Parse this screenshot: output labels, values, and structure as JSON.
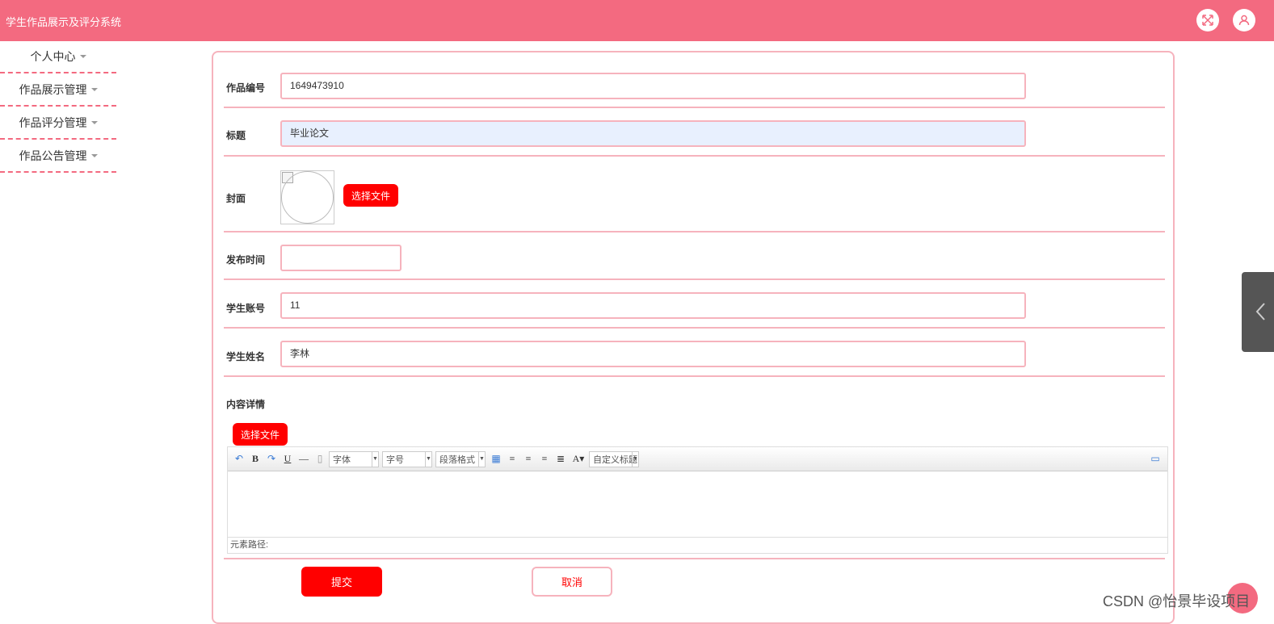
{
  "app": {
    "title": "学生作品展示及评分系统"
  },
  "header": {
    "fullscreen_icon": "fullscreen-icon",
    "user_icon": "user-icon"
  },
  "sidebar": {
    "items": [
      {
        "label": "个人中心"
      },
      {
        "label": "作品展示管理"
      },
      {
        "label": "作品评分管理"
      },
      {
        "label": "作品公告管理"
      }
    ]
  },
  "form": {
    "work_no": {
      "label": "作品编号",
      "value": "1649473910"
    },
    "title": {
      "label": "标题",
      "value": "毕业论文"
    },
    "cover": {
      "label": "封面",
      "button": "选择文件"
    },
    "publish_time": {
      "label": "发布时间",
      "value": ""
    },
    "student_account": {
      "label": "学生账号",
      "value": "11"
    },
    "student_name": {
      "label": "学生姓名",
      "value": "李林"
    },
    "content": {
      "label": "内容详情",
      "button": "选择文件"
    }
  },
  "editor": {
    "font_family": "字体",
    "font_size": "字号",
    "paragraph": "段落格式",
    "custom_title": "自定义标题",
    "status_path": "元素路径:"
  },
  "actions": {
    "submit": "提交",
    "cancel": "取消"
  },
  "watermark": "CSDN @怡景毕设项目",
  "colors": {
    "header": "#f36a80",
    "accent": "#ff0000",
    "border": "#f6b3bd"
  }
}
